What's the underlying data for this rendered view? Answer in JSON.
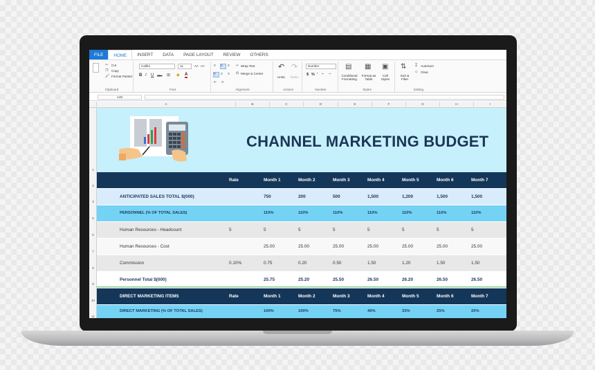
{
  "tabs": [
    "FILE",
    "HOME",
    "INSERT",
    "DATA",
    "PAGE LAYOUT",
    "REVIEW",
    "OTHERS"
  ],
  "ribbon": {
    "clipboard": {
      "cut": "Cut",
      "copy": "Copy",
      "format_painter": "Format Painter",
      "label": "Clipboard"
    },
    "font": {
      "name": "Calibri",
      "size": "11",
      "grow": "A˄",
      "shrink": "A˅",
      "bold": "B",
      "italic": "I",
      "underline": "U",
      "strike": "abc",
      "label": "Font"
    },
    "alignment": {
      "wrap": "Wrap Text",
      "merge": "Merge & Center",
      "label": "Alignment"
    },
    "actions": {
      "undo": "Undo",
      "redo": "Redo",
      "label": "Actions"
    },
    "number": {
      "format": "Number",
      "currency": "$",
      "percent": "%",
      "comma": "’",
      "label": "Number"
    },
    "styles": {
      "conditional": "Conditional Formatting",
      "format_table": "Format as Table",
      "cell_styles": "Cell Styles",
      "label": "Styles"
    },
    "editing": {
      "sort": "Sort & Filter",
      "autosum": "AutoSum",
      "clear": "Clear",
      "label": "Editing"
    }
  },
  "namebox": "A20",
  "columns": [
    "A",
    "B",
    "C",
    "D",
    "E",
    "F",
    "G",
    "H",
    "I"
  ],
  "row_numbers": [
    "1",
    "2",
    "3",
    "5",
    "6",
    "7",
    "8",
    "9",
    "10",
    "11"
  ],
  "title": "CHANNEL MARKETING BUDGET",
  "header_row": [
    "",
    "Rate",
    "Month 1",
    "Month 2",
    "Month 3",
    "Month 4",
    "Month 5",
    "Month 6",
    "Month 7"
  ],
  "rows": [
    {
      "style": "light",
      "cells": [
        "ANTICIPATED SALES TOTAL $(000)",
        "",
        "750",
        "200",
        "500",
        "1,500",
        "1,200",
        "1,500",
        "1,500"
      ]
    },
    {
      "style": "cyan",
      "cells": [
        "PERSONNEL (% OF TOTAL SALES)",
        "",
        "110%",
        "110%",
        "110%",
        "110%",
        "110%",
        "110%",
        "110%"
      ]
    },
    {
      "style": "grey",
      "cells": [
        "Human Resources - Headcount",
        "5",
        "5",
        "5",
        "5",
        "5",
        "5",
        "5",
        "5"
      ]
    },
    {
      "style": "white",
      "cells": [
        "Human Resources - Cost",
        "",
        "25.00",
        "25.00",
        "25.00",
        "25.00",
        "25.00",
        "25.00",
        "25.00"
      ]
    },
    {
      "style": "grey",
      "cells": [
        "Commission",
        "0.10%",
        "0.75",
        "0.20",
        "0.50",
        "1.50",
        "1.20",
        "1.50",
        "1.50"
      ]
    },
    {
      "style": "total",
      "cells": [
        "Personnel Total $(000)",
        "",
        "25.75",
        "25.20",
        "25.50",
        "26.50",
        "26.20",
        "26.50",
        "26.50"
      ]
    },
    {
      "style": "dark",
      "cells": [
        "DIRECT MARKETING ITEMS",
        "Rate",
        "Month 1",
        "Month 2",
        "Month 3",
        "Month 4",
        "Month 5",
        "Month 6",
        "Month 7"
      ]
    },
    {
      "style": "cyan",
      "cells": [
        "DIRECT MARKETING (% OF TOTAL SALES)",
        "",
        "100%",
        "100%",
        "75%",
        "40%",
        "33%",
        "25%",
        "20%"
      ]
    }
  ],
  "colors": {
    "file_tab": "#1e7ad6",
    "header_navy": "#143659",
    "banner": "#c6f0fb",
    "cyan_row": "#74d3f5",
    "title": "#1d3557"
  }
}
